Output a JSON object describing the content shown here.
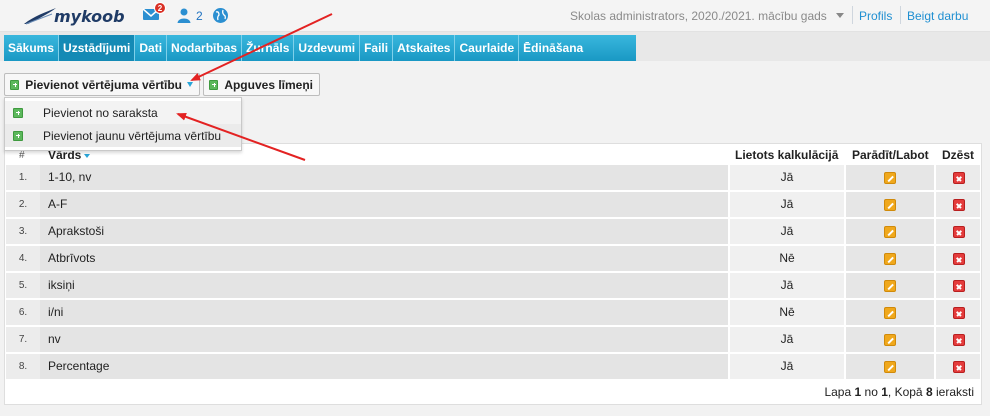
{
  "header": {
    "logo_text": "mykoob",
    "messages_badge": "2",
    "users_count": "2",
    "role": "Skolas administrators, 2020./2021. mācību gads",
    "links": {
      "profile": "Profils",
      "logout": "Beigt darbu"
    }
  },
  "nav": {
    "items": [
      {
        "label": "Sākums",
        "active": false
      },
      {
        "label": "Uzstādījumi",
        "active": true
      },
      {
        "label": "Dati",
        "active": false
      },
      {
        "label": "Nodarbības",
        "active": false
      },
      {
        "label": "Žurnāls",
        "active": false
      },
      {
        "label": "Uzdevumi",
        "active": false
      },
      {
        "label": "Faili",
        "active": false
      },
      {
        "label": "Atskaites",
        "active": false
      },
      {
        "label": "Caurlaide",
        "active": false
      },
      {
        "label": "Ēdināšana",
        "active": false
      }
    ],
    "accent": "#1fa6d4"
  },
  "toolbar": {
    "add_button": "Pievienot vērtējuma vērtību",
    "levels_button": "Apguves līmeņi"
  },
  "dropdown": {
    "items": [
      "Pievienot no saraksta",
      "Pievienot jaunu vērtējuma vērtību"
    ]
  },
  "table": {
    "headers": {
      "num": "#",
      "name": "Vārds",
      "calc": "Lietots kalkulācijā",
      "edit": "Parādīt/Labot",
      "delete": "Dzēst"
    },
    "rows": [
      {
        "num": "1.",
        "name": "1-10, nv",
        "calc": "Jā"
      },
      {
        "num": "2.",
        "name": "A-F",
        "calc": "Jā"
      },
      {
        "num": "3.",
        "name": "Aprakstoši",
        "calc": "Jā"
      },
      {
        "num": "4.",
        "name": "Atbrīvots",
        "calc": "Nē"
      },
      {
        "num": "5.",
        "name": "iksiņi",
        "calc": "Jā"
      },
      {
        "num": "6.",
        "name": "i/ni",
        "calc": "Nē"
      },
      {
        "num": "7.",
        "name": "nv",
        "calc": "Jā"
      },
      {
        "num": "8.",
        "name": "Percentage",
        "calc": "Jā"
      }
    ],
    "footer": {
      "page_label": "Lapa",
      "page": "1",
      "of_label": "no",
      "pages": "1",
      "total_label": ", Kopā",
      "total": "8",
      "records_label": "ieraksti"
    }
  },
  "annotation_color": "#e32222"
}
